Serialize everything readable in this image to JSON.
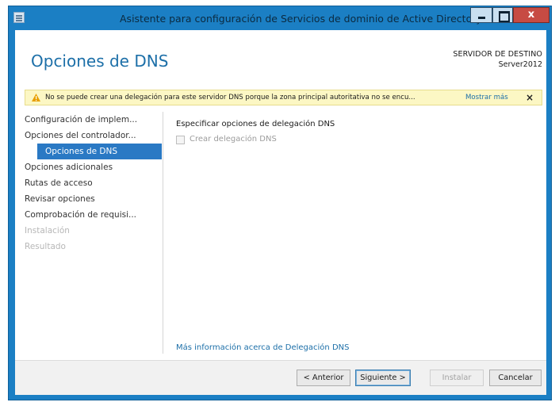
{
  "window": {
    "title": "Asistente para configuración de Servicios de dominio de Active Directory"
  },
  "header": {
    "page_title": "Opciones de DNS",
    "destination_label": "SERVIDOR DE DESTINO",
    "destination_server": "Server2012"
  },
  "warning": {
    "text": "No se puede crear una delegación para este servidor DNS porque la zona principal autoritativa no se encu...",
    "link": "Mostrar más",
    "close": "×"
  },
  "nav": {
    "items": [
      {
        "label": "Configuración de implem..."
      },
      {
        "label": "Opciones del controlador..."
      },
      {
        "label": "Opciones de DNS"
      },
      {
        "label": "Opciones adicionales"
      },
      {
        "label": "Rutas de acceso"
      },
      {
        "label": "Revisar opciones"
      },
      {
        "label": "Comprobación de requisi..."
      },
      {
        "label": "Instalación"
      },
      {
        "label": "Resultado"
      }
    ]
  },
  "main": {
    "section_label": "Especificar opciones de delegación DNS",
    "checkbox_label": "Crear delegación DNS",
    "checkbox_checked": false,
    "more_info_link": "Más información acerca de Delegación DNS"
  },
  "footer": {
    "prev_label": "< Anterior",
    "next_label": "Siguiente >",
    "install_label": "Instalar",
    "cancel_label": "Cancelar"
  },
  "colors": {
    "frame": "#1b7fc4",
    "title_accent": "#1c6fa8",
    "nav_active": "#2a79c4",
    "warning_bg": "#fcf7c4",
    "close_button": "#c74b43"
  }
}
